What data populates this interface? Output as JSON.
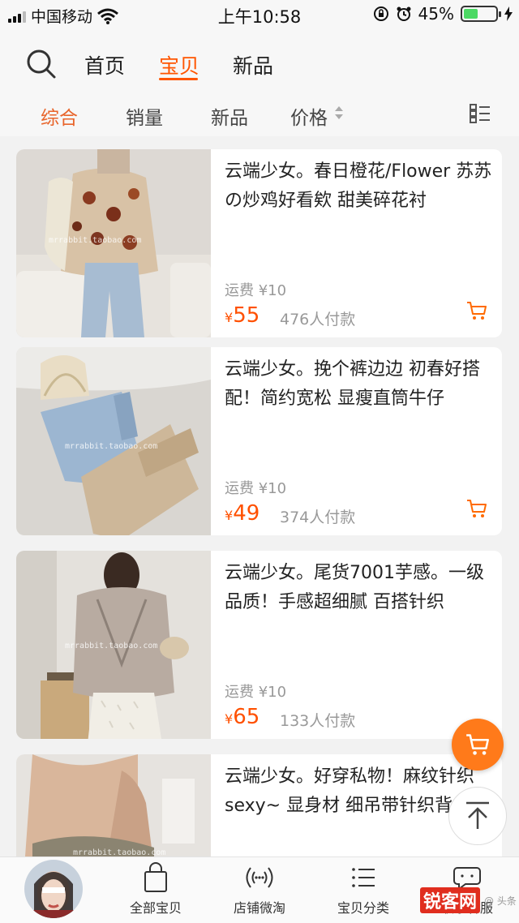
{
  "status_bar": {
    "carrier": "中国移动",
    "time": "上午10:58",
    "battery_percent": "45%",
    "battery_level": 0.45
  },
  "nav": {
    "tabs": [
      {
        "label": "首页",
        "active": false
      },
      {
        "label": "宝贝",
        "active": true
      },
      {
        "label": "新品",
        "active": false
      }
    ]
  },
  "sort": {
    "items": [
      {
        "label": "综合",
        "active": true
      },
      {
        "label": "销量",
        "active": false
      },
      {
        "label": "新品",
        "active": false
      },
      {
        "label": "价格",
        "active": false
      }
    ]
  },
  "products": [
    {
      "title": "云端少女。春日橙花/Flower 苏苏の炒鸡好看欸 甜美碎花衬",
      "shipping": "运费 ¥10",
      "currency": "¥",
      "price": "55",
      "sales": "476人付款",
      "image_watermark": "mrrabbit.taobao.com"
    },
    {
      "title": "云端少女。挽个裤边边 初春好搭配！简约宽松 显瘦直筒牛仔",
      "shipping": "运费 ¥10",
      "currency": "¥",
      "price": "49",
      "sales": "374人付款",
      "image_watermark": "mrrabbit.taobao.com"
    },
    {
      "title": "云端少女。尾货7001芋感。一级品质！手感超细腻 百搭针织",
      "shipping": "运费 ¥10",
      "currency": "¥",
      "price": "65",
      "sales": "133人付款",
      "image_watermark": "mrrabbit.taobao.com"
    },
    {
      "title": "云端少女。好穿私物！麻纹针织sexy~ 显身材 细吊带针织背",
      "shipping": "",
      "currency": "",
      "price": "",
      "sales": "",
      "image_watermark": "mrrabbit.taobao.com"
    }
  ],
  "bottom_bar": {
    "items": [
      {
        "label": "全部宝贝",
        "icon": "shopping-bag-icon"
      },
      {
        "label": "店铺微淘",
        "icon": "broadcast-icon"
      },
      {
        "label": "宝贝分类",
        "icon": "category-list-icon"
      },
      {
        "label": "联系客服",
        "icon": "chat-icon"
      }
    ]
  },
  "watermark": {
    "main": "锐客网",
    "small": "@ 头条"
  },
  "colors": {
    "accent": "#ff5500",
    "price": "#ff5000",
    "fab": "#ff7a1a"
  }
}
